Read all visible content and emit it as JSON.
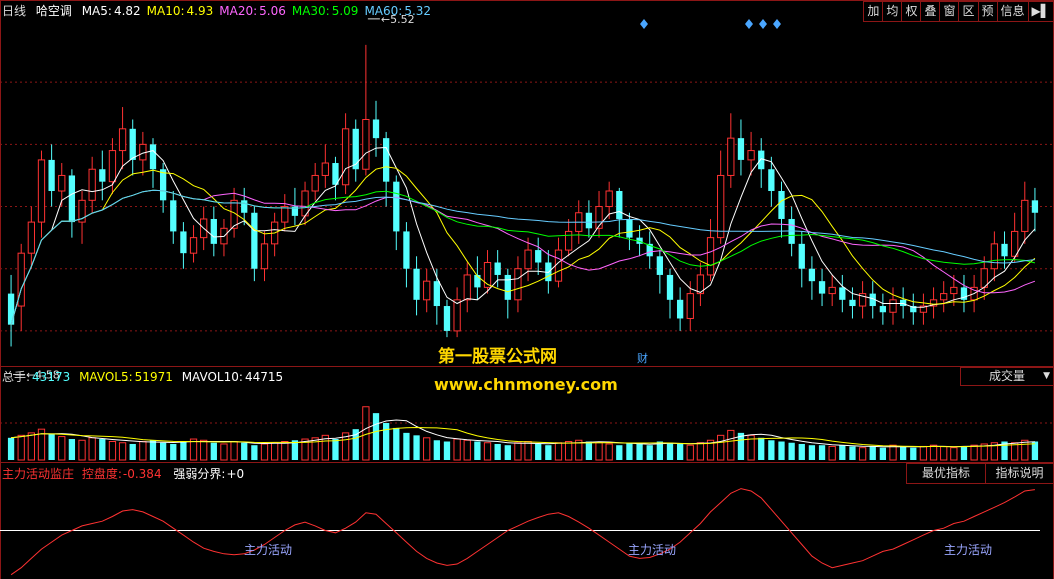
{
  "header": {
    "period": "日线",
    "name": "哈空调",
    "ma": [
      {
        "label": "MA5:",
        "value": "4.82",
        "color": "#ffffff"
      },
      {
        "label": "MA10:",
        "value": "4.93",
        "color": "#ffff00"
      },
      {
        "label": "MA20:",
        "value": "5.06",
        "color": "#ff66ff"
      },
      {
        "label": "MA30:",
        "value": "5.09",
        "color": "#00ff00"
      },
      {
        "label": "MA60:",
        "value": "5.32",
        "color": "#66ccff"
      }
    ]
  },
  "toolbar": [
    "加",
    "均",
    "权",
    "叠",
    "窗",
    "区",
    "预",
    "信息",
    "▶▌"
  ],
  "volume_header": {
    "total_label": "总手:",
    "total_value": "43173",
    "mavol5_label": "MAVOL5:",
    "mavol5_value": "51971",
    "mavol10_label": "MAVOL10:",
    "mavol10_value": "44715",
    "selector": "成交量"
  },
  "indicator_header": {
    "name": "主力活动监庄",
    "param_label": "控盘度:",
    "param_value": "-0.384",
    "split_label": "强弱分界:",
    "split_value": "+0",
    "btn_best": "最优指标",
    "btn_explain": "指标说明"
  },
  "watermark": {
    "line1": "第一股票公式网",
    "line2": "www.chnmoney.com"
  },
  "annotations": {
    "high": "5.52",
    "low": "4.58",
    "fin_marker": "财"
  },
  "signals": [
    "主力活动",
    "主力活动",
    "主力活动"
  ],
  "colors": {
    "up": "#ff3232",
    "down": "#54ffff",
    "grid": "#8c1616",
    "ind_line": "#ff3232",
    "diamond": "#4aa6ff"
  },
  "chart_data": {
    "type": "candlestick",
    "price_range": [
      4.5,
      5.6
    ],
    "candles": [
      [
        4.72,
        4.62,
        4.78,
        4.55
      ],
      [
        4.68,
        4.85,
        4.88,
        4.6
      ],
      [
        4.85,
        4.95,
        5.0,
        4.8
      ],
      [
        4.95,
        5.15,
        5.18,
        4.9
      ],
      [
        5.15,
        5.05,
        5.2,
        5.0
      ],
      [
        5.05,
        5.1,
        5.14,
        5.0
      ],
      [
        5.1,
        4.95,
        5.12,
        4.9
      ],
      [
        4.95,
        5.02,
        5.05,
        4.88
      ],
      [
        5.02,
        5.12,
        5.16,
        4.98
      ],
      [
        5.12,
        5.08,
        5.18,
        5.02
      ],
      [
        5.08,
        5.18,
        5.22,
        5.04
      ],
      [
        5.18,
        5.25,
        5.32,
        5.12
      ],
      [
        5.25,
        5.15,
        5.28,
        5.1
      ],
      [
        5.15,
        5.2,
        5.24,
        5.1
      ],
      [
        5.2,
        5.12,
        5.22,
        5.06
      ],
      [
        5.12,
        5.02,
        5.14,
        4.98
      ],
      [
        5.02,
        4.92,
        5.05,
        4.88
      ],
      [
        4.92,
        4.85,
        4.95,
        4.8
      ],
      [
        4.85,
        4.9,
        4.94,
        4.82
      ],
      [
        4.9,
        4.96,
        5.0,
        4.86
      ],
      [
        4.96,
        4.88,
        5.0,
        4.84
      ],
      [
        4.88,
        4.93,
        4.96,
        4.84
      ],
      [
        4.93,
        5.02,
        5.06,
        4.9
      ],
      [
        5.02,
        4.98,
        5.06,
        4.94
      ],
      [
        4.98,
        4.8,
        5.0,
        4.76
      ],
      [
        4.8,
        4.88,
        4.92,
        4.76
      ],
      [
        4.88,
        4.95,
        4.98,
        4.84
      ],
      [
        4.95,
        5.0,
        5.04,
        4.92
      ],
      [
        5.0,
        4.97,
        5.06,
        4.94
      ],
      [
        4.97,
        5.05,
        5.08,
        4.94
      ],
      [
        5.05,
        5.1,
        5.14,
        5.02
      ],
      [
        5.1,
        5.14,
        5.2,
        5.06
      ],
      [
        5.14,
        5.07,
        5.16,
        5.02
      ],
      [
        5.07,
        5.25,
        5.3,
        5.04
      ],
      [
        5.25,
        5.12,
        5.28,
        5.08
      ],
      [
        5.12,
        5.28,
        5.52,
        5.1
      ],
      [
        5.28,
        5.22,
        5.34,
        5.16
      ],
      [
        5.22,
        5.08,
        5.24,
        5.0
      ],
      [
        5.08,
        4.92,
        5.1,
        4.86
      ],
      [
        4.92,
        4.8,
        4.95,
        4.74
      ],
      [
        4.8,
        4.7,
        4.84,
        4.65
      ],
      [
        4.7,
        4.76,
        4.8,
        4.66
      ],
      [
        4.76,
        4.68,
        4.8,
        4.62
      ],
      [
        4.68,
        4.6,
        4.7,
        4.58
      ],
      [
        4.6,
        4.7,
        4.74,
        4.58
      ],
      [
        4.7,
        4.78,
        4.82,
        4.66
      ],
      [
        4.78,
        4.74,
        4.84,
        4.7
      ],
      [
        4.74,
        4.82,
        4.86,
        4.72
      ],
      [
        4.82,
        4.78,
        4.86,
        4.74
      ],
      [
        4.78,
        4.7,
        4.8,
        4.64
      ],
      [
        4.7,
        4.8,
        4.84,
        4.66
      ],
      [
        4.8,
        4.86,
        4.9,
        4.76
      ],
      [
        4.86,
        4.82,
        4.9,
        4.78
      ],
      [
        4.82,
        4.76,
        4.86,
        4.72
      ],
      [
        4.76,
        4.86,
        4.9,
        4.74
      ],
      [
        4.86,
        4.92,
        4.96,
        4.84
      ],
      [
        4.92,
        4.98,
        5.02,
        4.88
      ],
      [
        4.98,
        4.93,
        5.02,
        4.9
      ],
      [
        4.93,
        5.0,
        5.05,
        4.9
      ],
      [
        5.0,
        5.05,
        5.08,
        4.96
      ],
      [
        5.05,
        4.96,
        5.06,
        4.9
      ],
      [
        4.96,
        4.9,
        4.98,
        4.86
      ],
      [
        4.9,
        4.88,
        4.94,
        4.84
      ],
      [
        4.88,
        4.84,
        4.92,
        4.8
      ],
      [
        4.84,
        4.78,
        4.86,
        4.72
      ],
      [
        4.78,
        4.7,
        4.8,
        4.64
      ],
      [
        4.7,
        4.64,
        4.74,
        4.6
      ],
      [
        4.64,
        4.72,
        4.76,
        4.6
      ],
      [
        4.72,
        4.78,
        4.82,
        4.68
      ],
      [
        4.78,
        4.9,
        4.96,
        4.76
      ],
      [
        4.9,
        5.1,
        5.18,
        4.88
      ],
      [
        5.1,
        5.22,
        5.3,
        5.06
      ],
      [
        5.22,
        5.15,
        5.28,
        5.1
      ],
      [
        5.15,
        5.18,
        5.24,
        5.1
      ],
      [
        5.18,
        5.12,
        5.22,
        5.06
      ],
      [
        5.12,
        5.05,
        5.16,
        5.0
      ],
      [
        5.05,
        4.96,
        5.08,
        4.9
      ],
      [
        4.96,
        4.88,
        5.0,
        4.84
      ],
      [
        4.88,
        4.8,
        4.92,
        4.74
      ],
      [
        4.8,
        4.76,
        4.84,
        4.7
      ],
      [
        4.76,
        4.72,
        4.8,
        4.68
      ],
      [
        4.72,
        4.74,
        4.78,
        4.68
      ],
      [
        4.74,
        4.7,
        4.78,
        4.66
      ],
      [
        4.7,
        4.68,
        4.74,
        4.64
      ],
      [
        4.68,
        4.72,
        4.76,
        4.64
      ],
      [
        4.72,
        4.68,
        4.76,
        4.64
      ],
      [
        4.68,
        4.66,
        4.72,
        4.62
      ],
      [
        4.66,
        4.7,
        4.74,
        4.62
      ],
      [
        4.7,
        4.68,
        4.74,
        4.64
      ],
      [
        4.68,
        4.66,
        4.72,
        4.62
      ],
      [
        4.66,
        4.68,
        4.72,
        4.62
      ],
      [
        4.68,
        4.7,
        4.74,
        4.64
      ],
      [
        4.7,
        4.72,
        4.76,
        4.66
      ],
      [
        4.72,
        4.74,
        4.78,
        4.68
      ],
      [
        4.74,
        4.7,
        4.78,
        4.66
      ],
      [
        4.7,
        4.74,
        4.78,
        4.66
      ],
      [
        4.74,
        4.8,
        4.84,
        4.7
      ],
      [
        4.8,
        4.88,
        4.92,
        4.76
      ],
      [
        4.88,
        4.84,
        4.92,
        4.8
      ],
      [
        4.84,
        4.92,
        4.98,
        4.82
      ],
      [
        4.92,
        5.02,
        5.08,
        4.88
      ],
      [
        5.02,
        4.98,
        5.06,
        4.92
      ]
    ],
    "volume_range": [
      0,
      60000
    ],
    "volumes": [
      18000,
      20000,
      22000,
      25000,
      21000,
      19000,
      17000,
      16000,
      18000,
      17000,
      15000,
      14000,
      13000,
      15000,
      16000,
      14000,
      13000,
      15000,
      17000,
      16000,
      14000,
      13000,
      15000,
      14000,
      12000,
      13000,
      14000,
      15000,
      16000,
      17000,
      18000,
      20000,
      17000,
      22000,
      25000,
      43173,
      38000,
      30000,
      26000,
      22000,
      20000,
      18000,
      16000,
      15000,
      17000,
      16000,
      15000,
      14000,
      13000,
      12000,
      14000,
      15000,
      13000,
      12000,
      14000,
      15000,
      16000,
      15000,
      14000,
      13000,
      12000,
      14000,
      13000,
      12000,
      15000,
      14000,
      13000,
      12000,
      14000,
      16000,
      20000,
      24000,
      22000,
      20000,
      18000,
      16000,
      15000,
      14000,
      13000,
      12000,
      12000,
      11000,
      12000,
      11000,
      10000,
      11000,
      10000,
      12000,
      11000,
      10000,
      11000,
      12000,
      11000,
      10000,
      11000,
      12000,
      13000,
      14000,
      15000,
      14000,
      16000,
      15000
    ],
    "indicator_range": [
      -1,
      1
    ],
    "indicator": [
      -0.95,
      -0.8,
      -0.6,
      -0.4,
      -0.25,
      -0.1,
      0.0,
      0.1,
      0.15,
      0.2,
      0.3,
      0.42,
      0.45,
      0.4,
      0.3,
      0.2,
      0.05,
      -0.1,
      -0.25,
      -0.38,
      -0.45,
      -0.5,
      -0.52,
      -0.5,
      -0.42,
      -0.3,
      -0.15,
      0.0,
      0.12,
      0.18,
      0.1,
      0.0,
      -0.05,
      0.05,
      0.18,
      0.38,
      0.35,
      0.15,
      -0.05,
      -0.25,
      -0.45,
      -0.6,
      -0.7,
      -0.75,
      -0.72,
      -0.6,
      -0.45,
      -0.3,
      -0.15,
      0.0,
      0.1,
      0.2,
      0.28,
      0.35,
      0.38,
      0.3,
      0.18,
      0.05,
      -0.1,
      -0.25,
      -0.4,
      -0.55,
      -0.6,
      -0.58,
      -0.5,
      -0.4,
      -0.25,
      -0.05,
      0.15,
      0.4,
      0.6,
      0.8,
      0.9,
      0.85,
      0.7,
      0.45,
      0.2,
      -0.05,
      -0.3,
      -0.55,
      -0.7,
      -0.8,
      -0.75,
      -0.7,
      -0.65,
      -0.55,
      -0.45,
      -0.4,
      -0.3,
      -0.2,
      -0.1,
      0.0,
      0.05,
      0.15,
      0.2,
      0.3,
      0.4,
      0.5,
      0.6,
      0.72,
      0.85,
      0.88
    ]
  }
}
